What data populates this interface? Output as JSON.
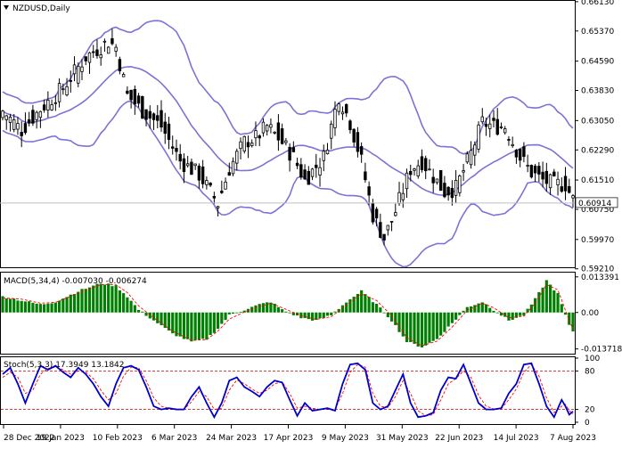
{
  "symbol_label": "NZDUSD,Daily",
  "macd_label": "MACD(5,34,4)",
  "macd_values": "-0.007030 -0.006274",
  "stoch_label": "Stoch(5,3,3)",
  "stoch_values": "17.3949 13.1842",
  "current_price_label": "0.60914",
  "colors": {
    "candle": "#000000",
    "bands": "#7b73d6",
    "macd_hist": "#008000",
    "macd_signal": "#ff0000",
    "stoch_main": "#0000cc",
    "stoch_signal": "#ff0000",
    "level_line": "#cc0000",
    "price_line": "#c0c0c0",
    "axis": "#000000"
  },
  "chart_data": [
    {
      "type": "candlestick",
      "title": "NZDUSD,Daily",
      "ylim": [
        0.5925,
        0.6615
      ],
      "yticks": [
        "0.66130",
        "0.65370",
        "0.64590",
        "0.63830",
        "0.63050",
        "0.62290",
        "0.61510",
        "0.60750",
        "0.59970",
        "0.59210"
      ],
      "ytick_values": [
        0.6613,
        0.6537,
        0.6459,
        0.6383,
        0.6305,
        0.6229,
        0.6151,
        0.6075,
        0.5997,
        0.5921
      ],
      "x_labels": [
        "28 Dec 2022",
        "19 Jan 2023",
        "10 Feb 2023",
        "6 Mar 2023",
        "24 Mar 2023",
        "17 Apr 2023",
        "9 May 2023",
        "31 May 2023",
        "22 Jun 2023",
        "14 Jul 2023",
        "7 Aug 2023"
      ],
      "current_price": 0.60914,
      "bands": {
        "period": 20,
        "deviation": 2
      },
      "close_path": [
        [
          0,
          0.633
        ],
        [
          5,
          0.628
        ],
        [
          10,
          0.6335
        ],
        [
          16,
          0.639
        ],
        [
          22,
          0.647
        ],
        [
          28,
          0.651
        ],
        [
          30,
          0.6495
        ],
        [
          33,
          0.637
        ],
        [
          37,
          0.633
        ],
        [
          42,
          0.629
        ],
        [
          47,
          0.62
        ],
        [
          52,
          0.6165
        ],
        [
          55,
          0.612
        ],
        [
          57,
          0.609
        ],
        [
          60,
          0.618
        ],
        [
          64,
          0.625
        ],
        [
          67,
          0.626
        ],
        [
          70,
          0.629
        ],
        [
          73,
          0.626
        ],
        [
          77,
          0.621
        ],
        [
          80,
          0.615
        ],
        [
          85,
          0.621
        ],
        [
          89,
          0.637
        ],
        [
          92,
          0.63
        ],
        [
          95,
          0.62
        ],
        [
          98,
          0.606
        ],
        [
          101,
          0.6
        ],
        [
          104,
          0.607
        ],
        [
          108,
          0.618
        ],
        [
          111,
          0.62
        ],
        [
          114,
          0.616
        ],
        [
          117,
          0.612
        ],
        [
          120,
          0.613
        ],
        [
          124,
          0.622
        ],
        [
          127,
          0.63
        ],
        [
          130,
          0.629
        ],
        [
          133,
          0.629
        ],
        [
          137,
          0.621
        ],
        [
          140,
          0.617
        ],
        [
          143,
          0.615
        ],
        [
          146,
          0.614
        ],
        [
          149,
          0.614
        ],
        [
          151,
          0.61
        ]
      ],
      "open_path": [
        [
          0,
          0.631
        ],
        [
          5,
          0.6295
        ],
        [
          10,
          0.632
        ],
        [
          16,
          0.637
        ],
        [
          22,
          0.645
        ],
        [
          28,
          0.65
        ],
        [
          30,
          0.6505
        ],
        [
          33,
          0.64
        ],
        [
          37,
          0.635
        ],
        [
          42,
          0.631
        ],
        [
          47,
          0.622
        ],
        [
          52,
          0.618
        ],
        [
          55,
          0.614
        ],
        [
          57,
          0.61
        ],
        [
          60,
          0.616
        ],
        [
          64,
          0.623
        ],
        [
          67,
          0.6255
        ],
        [
          70,
          0.6275
        ],
        [
          73,
          0.628
        ],
        [
          77,
          0.623
        ],
        [
          80,
          0.617
        ],
        [
          85,
          0.619
        ],
        [
          89,
          0.634
        ],
        [
          92,
          0.632
        ],
        [
          95,
          0.623
        ],
        [
          98,
          0.609
        ],
        [
          101,
          0.602
        ],
        [
          104,
          0.605
        ],
        [
          108,
          0.616
        ],
        [
          111,
          0.619
        ],
        [
          114,
          0.618
        ],
        [
          117,
          0.614
        ],
        [
          120,
          0.612
        ],
        [
          124,
          0.62
        ],
        [
          127,
          0.628
        ],
        [
          130,
          0.63
        ],
        [
          133,
          0.6285
        ],
        [
          137,
          0.623
        ],
        [
          140,
          0.619
        ],
        [
          143,
          0.616
        ],
        [
          146,
          0.615
        ],
        [
          149,
          0.6145
        ],
        [
          151,
          0.612
        ]
      ],
      "wick_up": 0.003,
      "wick_down": 0.003,
      "bar_count": 152
    },
    {
      "type": "bar",
      "title": "MACD(5,34,4)",
      "ylim": [
        -0.0155,
        0.015
      ],
      "yticks": [
        "0.013391",
        "0.00",
        "-0.013718"
      ],
      "ytick_values": [
        0.013391,
        0.0,
        -0.013718
      ],
      "hist_path": [
        [
          0,
          0.006
        ],
        [
          5,
          0.0045
        ],
        [
          10,
          0.003
        ],
        [
          14,
          0.004
        ],
        [
          20,
          0.008
        ],
        [
          26,
          0.011
        ],
        [
          30,
          0.01
        ],
        [
          33,
          0.006
        ],
        [
          36,
          0.001
        ],
        [
          40,
          -0.003
        ],
        [
          45,
          -0.008
        ],
        [
          50,
          -0.011
        ],
        [
          54,
          -0.01
        ],
        [
          57,
          -0.006
        ],
        [
          60,
          -0.001
        ],
        [
          64,
          0.001
        ],
        [
          68,
          0.003
        ],
        [
          71,
          0.004
        ],
        [
          74,
          0.001
        ],
        [
          79,
          -0.002
        ],
        [
          83,
          -0.003
        ],
        [
          87,
          -0.001
        ],
        [
          91,
          0.004
        ],
        [
          95,
          0.008
        ],
        [
          99,
          0.003
        ],
        [
          103,
          -0.003
        ],
        [
          107,
          -0.011
        ],
        [
          111,
          -0.013
        ],
        [
          115,
          -0.01
        ],
        [
          119,
          -0.004
        ],
        [
          123,
          0.002
        ],
        [
          127,
          0.004
        ],
        [
          130,
          0.001
        ],
        [
          134,
          -0.003
        ],
        [
          138,
          -0.001
        ],
        [
          141,
          0.005
        ],
        [
          144,
          0.012
        ],
        [
          147,
          0.007
        ],
        [
          150,
          -0.005
        ],
        [
          151,
          -0.007
        ]
      ],
      "signal_path": [
        [
          0,
          0.0055
        ],
        [
          5,
          0.005
        ],
        [
          10,
          0.0035
        ],
        [
          14,
          0.0038
        ],
        [
          20,
          0.0072
        ],
        [
          26,
          0.0105
        ],
        [
          30,
          0.0104
        ],
        [
          33,
          0.0075
        ],
        [
          36,
          0.0025
        ],
        [
          40,
          -0.002
        ],
        [
          45,
          -0.007
        ],
        [
          50,
          -0.0105
        ],
        [
          54,
          -0.0102
        ],
        [
          57,
          -0.007
        ],
        [
          60,
          -0.0025
        ],
        [
          64,
          0.0002
        ],
        [
          68,
          0.0022
        ],
        [
          71,
          0.0035
        ],
        [
          74,
          0.0018
        ],
        [
          79,
          -0.0012
        ],
        [
          83,
          -0.0026
        ],
        [
          87,
          -0.0016
        ],
        [
          91,
          0.0028
        ],
        [
          95,
          0.007
        ],
        [
          99,
          0.0045
        ],
        [
          103,
          -0.0012
        ],
        [
          107,
          -0.0095
        ],
        [
          111,
          -0.0125
        ],
        [
          115,
          -0.0108
        ],
        [
          119,
          -0.0055
        ],
        [
          123,
          0.0008
        ],
        [
          127,
          0.0035
        ],
        [
          130,
          0.0018
        ],
        [
          134,
          -0.002
        ],
        [
          138,
          -0.0014
        ],
        [
          141,
          0.0035
        ],
        [
          144,
          0.0105
        ],
        [
          147,
          0.0085
        ],
        [
          150,
          -0.003
        ],
        [
          151,
          -0.0063
        ]
      ]
    },
    {
      "type": "line",
      "title": "Stoch(5,3,3)",
      "ylim": [
        0,
        100
      ],
      "yticks": [
        "100",
        "80",
        "20",
        "0"
      ],
      "ytick_values": [
        100,
        80,
        20,
        0
      ],
      "levels": [
        80,
        20
      ],
      "main_path": [
        [
          0,
          75
        ],
        [
          2,
          85
        ],
        [
          4,
          60
        ],
        [
          6,
          30
        ],
        [
          8,
          60
        ],
        [
          10,
          88
        ],
        [
          12,
          82
        ],
        [
          14,
          88
        ],
        [
          16,
          78
        ],
        [
          18,
          70
        ],
        [
          20,
          85
        ],
        [
          22,
          75
        ],
        [
          24,
          60
        ],
        [
          26,
          40
        ],
        [
          28,
          25
        ],
        [
          30,
          60
        ],
        [
          32,
          85
        ],
        [
          34,
          88
        ],
        [
          36,
          82
        ],
        [
          38,
          55
        ],
        [
          40,
          25
        ],
        [
          42,
          20
        ],
        [
          44,
          22
        ],
        [
          46,
          20
        ],
        [
          48,
          20
        ],
        [
          50,
          40
        ],
        [
          52,
          55
        ],
        [
          54,
          30
        ],
        [
          56,
          8
        ],
        [
          58,
          30
        ],
        [
          60,
          65
        ],
        [
          62,
          70
        ],
        [
          64,
          55
        ],
        [
          66,
          48
        ],
        [
          68,
          40
        ],
        [
          70,
          55
        ],
        [
          72,
          65
        ],
        [
          74,
          62
        ],
        [
          76,
          35
        ],
        [
          78,
          10
        ],
        [
          80,
          30
        ],
        [
          82,
          18
        ],
        [
          84,
          20
        ],
        [
          86,
          22
        ],
        [
          88,
          18
        ],
        [
          90,
          60
        ],
        [
          92,
          90
        ],
        [
          94,
          92
        ],
        [
          96,
          82
        ],
        [
          98,
          30
        ],
        [
          100,
          20
        ],
        [
          102,
          25
        ],
        [
          104,
          50
        ],
        [
          106,
          75
        ],
        [
          108,
          30
        ],
        [
          110,
          8
        ],
        [
          112,
          10
        ],
        [
          114,
          15
        ],
        [
          116,
          50
        ],
        [
          118,
          70
        ],
        [
          120,
          68
        ],
        [
          122,
          90
        ],
        [
          124,
          60
        ],
        [
          126,
          30
        ],
        [
          128,
          20
        ],
        [
          130,
          20
        ],
        [
          132,
          22
        ],
        [
          134,
          45
        ],
        [
          136,
          60
        ],
        [
          138,
          90
        ],
        [
          140,
          92
        ],
        [
          142,
          60
        ],
        [
          144,
          25
        ],
        [
          146,
          8
        ],
        [
          148,
          35
        ],
        [
          149,
          25
        ],
        [
          150,
          12
        ],
        [
          151,
          17
        ]
      ],
      "signal_path": [
        [
          0,
          70
        ],
        [
          2,
          78
        ],
        [
          4,
          70
        ],
        [
          6,
          45
        ],
        [
          8,
          50
        ],
        [
          10,
          75
        ],
        [
          12,
          84
        ],
        [
          14,
          86
        ],
        [
          16,
          82
        ],
        [
          18,
          75
        ],
        [
          20,
          80
        ],
        [
          22,
          78
        ],
        [
          24,
          68
        ],
        [
          26,
          50
        ],
        [
          28,
          35
        ],
        [
          30,
          45
        ],
        [
          32,
          72
        ],
        [
          34,
          86
        ],
        [
          36,
          85
        ],
        [
          38,
          65
        ],
        [
          40,
          38
        ],
        [
          42,
          25
        ],
        [
          44,
          22
        ],
        [
          46,
          21
        ],
        [
          48,
          20
        ],
        [
          50,
          32
        ],
        [
          52,
          48
        ],
        [
          54,
          40
        ],
        [
          56,
          20
        ],
        [
          58,
          22
        ],
        [
          60,
          50
        ],
        [
          62,
          66
        ],
        [
          64,
          60
        ],
        [
          66,
          52
        ],
        [
          68,
          45
        ],
        [
          70,
          50
        ],
        [
          72,
          60
        ],
        [
          74,
          63
        ],
        [
          76,
          45
        ],
        [
          78,
          22
        ],
        [
          80,
          25
        ],
        [
          82,
          22
        ],
        [
          84,
          20
        ],
        [
          86,
          21
        ],
        [
          88,
          20
        ],
        [
          90,
          45
        ],
        [
          92,
          78
        ],
        [
          94,
          90
        ],
        [
          96,
          86
        ],
        [
          98,
          45
        ],
        [
          100,
          25
        ],
        [
          102,
          23
        ],
        [
          104,
          40
        ],
        [
          106,
          65
        ],
        [
          108,
          45
        ],
        [
          110,
          18
        ],
        [
          112,
          10
        ],
        [
          114,
          12
        ],
        [
          116,
          35
        ],
        [
          118,
          60
        ],
        [
          120,
          68
        ],
        [
          122,
          80
        ],
        [
          124,
          70
        ],
        [
          126,
          42
        ],
        [
          128,
          25
        ],
        [
          130,
          21
        ],
        [
          132,
          21
        ],
        [
          134,
          35
        ],
        [
          136,
          52
        ],
        [
          138,
          78
        ],
        [
          140,
          90
        ],
        [
          142,
          72
        ],
        [
          144,
          38
        ],
        [
          146,
          15
        ],
        [
          148,
          25
        ],
        [
          149,
          28
        ],
        [
          150,
          18
        ],
        [
          151,
          13
        ]
      ]
    }
  ]
}
